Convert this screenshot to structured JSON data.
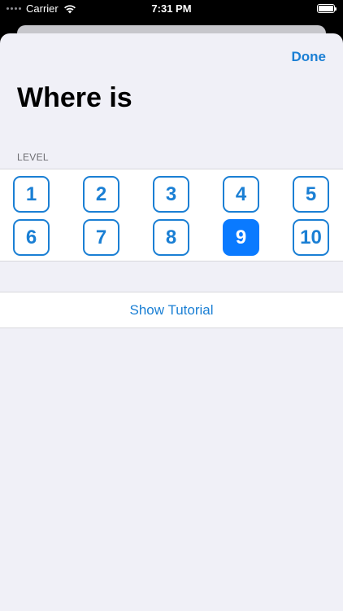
{
  "status_bar": {
    "carrier": "Carrier",
    "time": "7:31 PM",
    "wifi_icon": "wifi-icon",
    "battery_icon": "battery-icon"
  },
  "sheet": {
    "done_label": "Done",
    "title": "Where is"
  },
  "level": {
    "header": "LEVEL",
    "selected": "9",
    "options": [
      "1",
      "2",
      "3",
      "4",
      "5",
      "6",
      "7",
      "8",
      "9",
      "10"
    ]
  },
  "tutorial": {
    "label": "Show Tutorial"
  },
  "colors": {
    "accent": "#1a7fd4",
    "selected_fill": "#0a7aff",
    "sheet_background": "#f0f0f7"
  }
}
